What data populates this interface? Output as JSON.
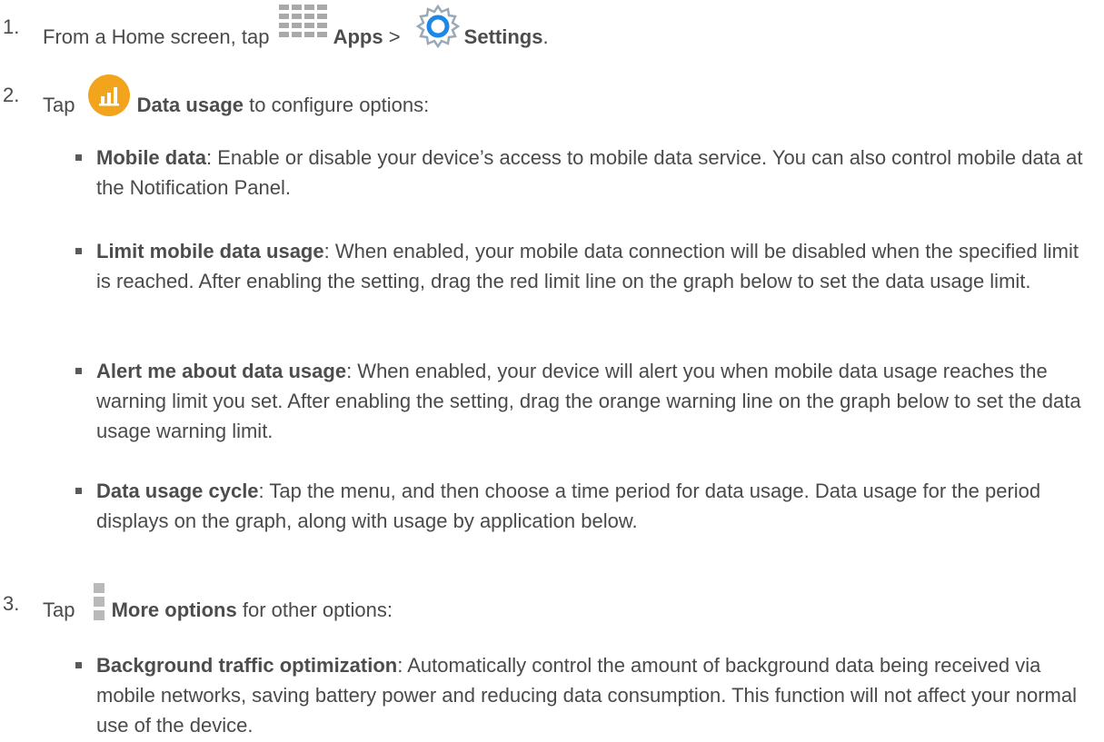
{
  "steps": [
    {
      "number": "1.",
      "prefix": "From a Home screen, tap",
      "apps_label": "Apps",
      "separator": ">",
      "settings_label": "Settings",
      "suffix": ".",
      "icons": [
        "apps-icon",
        "settings-icon"
      ]
    },
    {
      "number": "2.",
      "prefix": "Tap",
      "label": "Data usage",
      "suffix": "to configure options:",
      "icon": "data-usage-icon",
      "icon_color": "#f2a41c",
      "bullets": [
        {
          "term": "Mobile data",
          "text": ": Enable or disable your device’s access to mobile data service. You can also control mobile data at the Notification Panel."
        },
        {
          "term": "Limit mobile data usage",
          "text": ": When enabled, your mobile data connection will be disabled when the specified limit is reached. After enabling the setting, drag the red limit line on the graph below to set the data usage limit."
        },
        {
          "term": "Alert me about data usage",
          "text": ": When enabled, your device will alert you when mobile data usage reaches the warning limit you set. After enabling the setting, drag the orange warning line on the graph below to set the data usage warning limit."
        },
        {
          "term": "Data usage cycle",
          "text": ": Tap the menu, and then choose a time period for data usage. Data usage for the period displays on the graph, along with usage by application below."
        }
      ]
    },
    {
      "number": "3.",
      "prefix": "Tap",
      "label": "More options",
      "suffix": "for other options:",
      "icon": "more-options-icon",
      "bullets": [
        {
          "term": "Background traffic optimization",
          "text": ": Automatically control the amount of background data being received via mobile networks, saving battery power and reducing data consumption. This function will not affect your normal use of the device."
        }
      ]
    }
  ]
}
